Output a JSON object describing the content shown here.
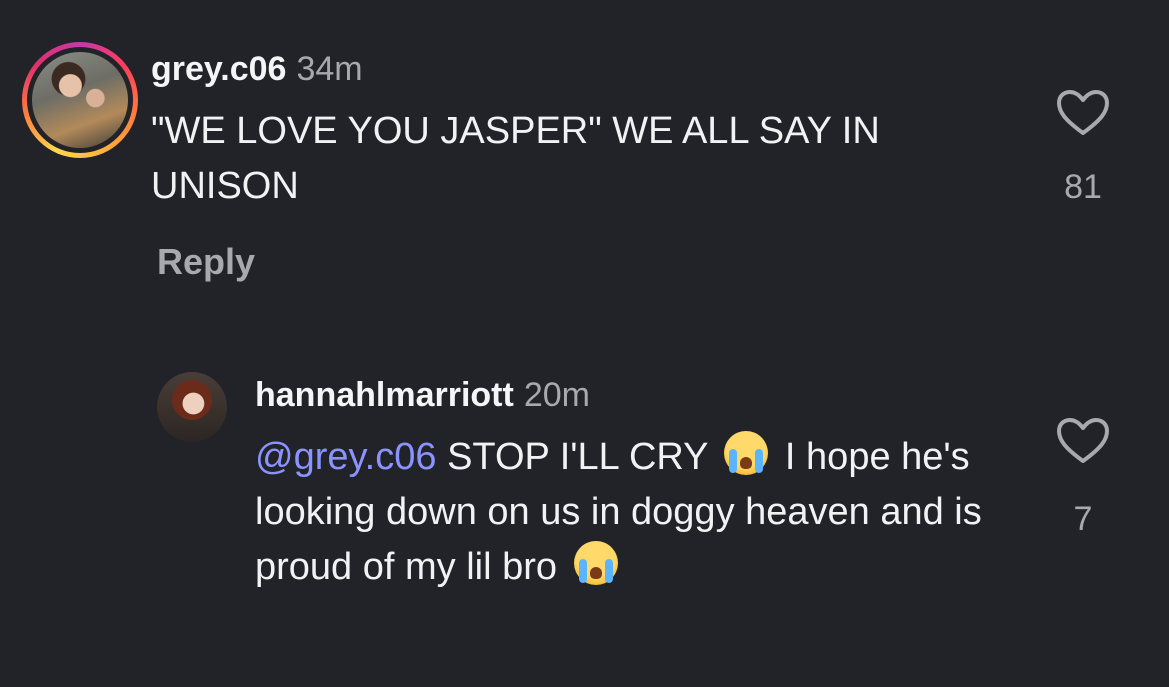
{
  "comments": [
    {
      "username": "grey.c06",
      "time": "34m",
      "text": "\"WE LOVE YOU JASPER\" WE ALL SAY IN UNISON",
      "likes": "81",
      "reply_label": "Reply",
      "avatar_icon": "avatar-with-story-ring"
    },
    {
      "username": "hannahlmarriott",
      "time": "20m",
      "mention": "@grey.c06",
      "text_part1": " STOP I'LL CRY ",
      "text_part2": " I hope he's looking down on us in doggy heaven and is proud of my lil bro ",
      "emoji_icon": "loudly-crying-face-emoji",
      "likes": "7",
      "avatar_icon": "avatar"
    }
  ],
  "colors": {
    "background": "#222328",
    "mention": "#8a93ff",
    "secondary_text": "#a8a8ad"
  }
}
